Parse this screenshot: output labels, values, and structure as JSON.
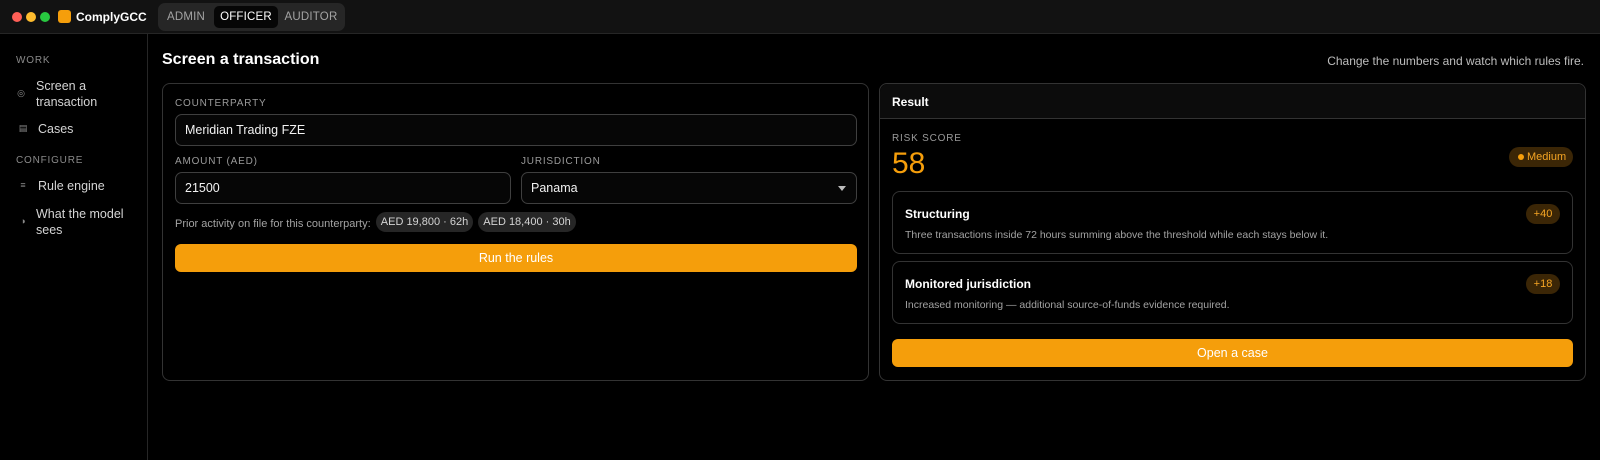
{
  "app": {
    "name": "ComplyGCC",
    "roles": [
      "ADMIN",
      "OFFICER",
      "AUDITOR"
    ],
    "active_role": "OFFICER"
  },
  "sidebar": {
    "sections": [
      {
        "label": "WORK",
        "items": [
          {
            "label": "Screen a transaction",
            "icon": "screen-icon"
          },
          {
            "label": "Cases",
            "icon": "cases-icon"
          }
        ]
      },
      {
        "label": "CONFIGURE",
        "items": [
          {
            "label": "Rule engine",
            "icon": "rule-engine-icon"
          },
          {
            "label": "What the model sees",
            "icon": "half-circle-icon"
          }
        ]
      }
    ]
  },
  "page": {
    "title": "Screen a transaction",
    "hint": "Change the numbers and watch which rules fire."
  },
  "form": {
    "counterparty_label": "COUNTERPARTY",
    "counterparty_value": "Meridian Trading FZE",
    "amount_label": "AMOUNT (AED)",
    "amount_value": "21500",
    "jurisdiction_label": "JURISDICTION",
    "jurisdiction_value": "Panama",
    "prior_activity_text": "Prior activity on file for this counterparty:",
    "prior_activity": [
      "AED 19,800 · 62h",
      "AED 18,400 · 30h"
    ],
    "run_button": "Run the rules"
  },
  "result": {
    "title": "Result",
    "risk_label": "RISK SCORE",
    "risk_score": "58",
    "risk_level": "Medium",
    "rules": [
      {
        "title": "Structuring",
        "points": "+40",
        "description": "Three transactions inside 72 hours summing above the threshold while each stays below it."
      },
      {
        "title": "Monitored jurisdiction",
        "points": "+18",
        "description": "Increased monitoring — additional source-of-funds evidence required."
      }
    ],
    "open_case_button": "Open a case"
  },
  "colors": {
    "accent": "#f59e0b",
    "background": "#000000",
    "panel_border": "#333333"
  }
}
